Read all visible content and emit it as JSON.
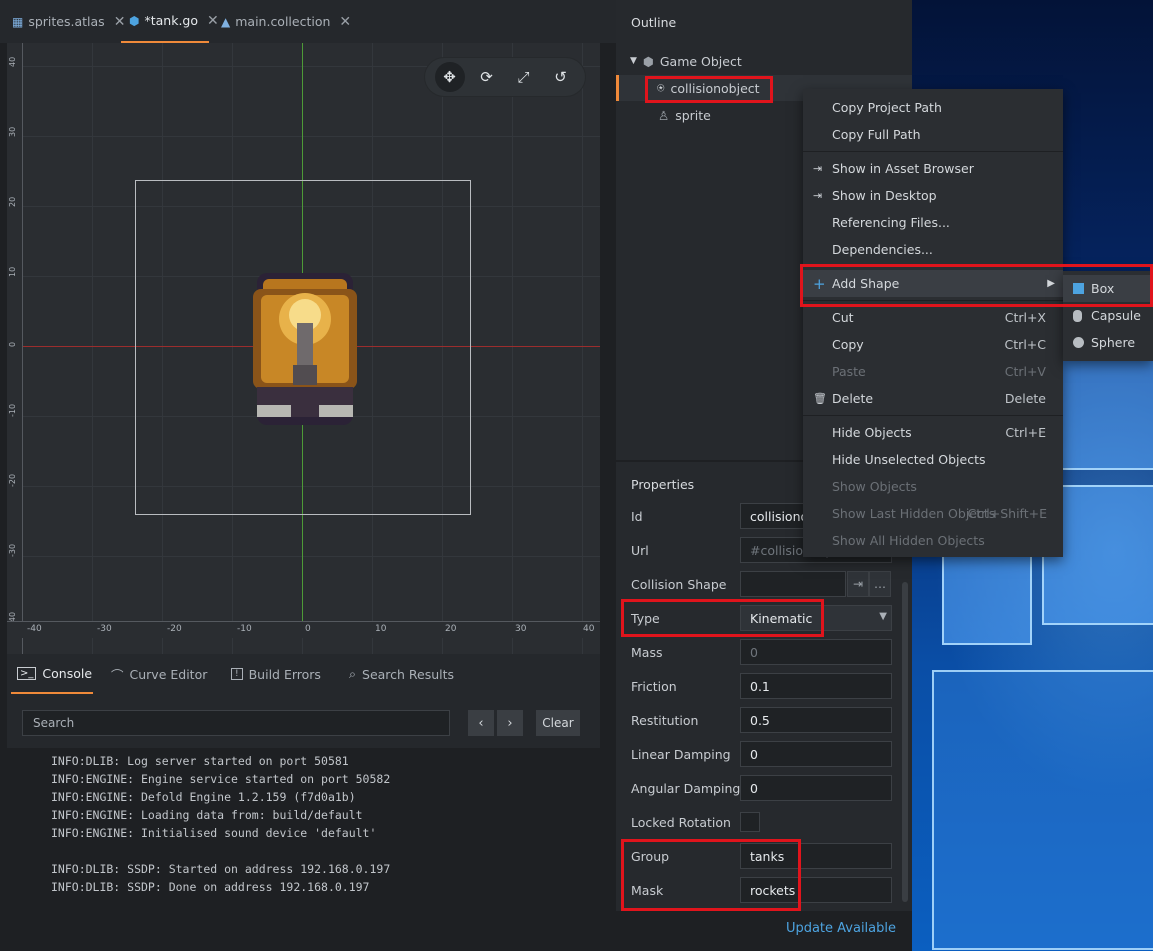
{
  "editor_tabs": [
    {
      "label": "sprites.atlas"
    },
    {
      "label": "*tank.go"
    },
    {
      "label": "main.collection"
    }
  ],
  "scene": {
    "y_ticks": [
      "40",
      "30",
      "20",
      "10",
      "0",
      "-10",
      "-20",
      "-30",
      "-40"
    ],
    "x_ticks": [
      "-40",
      "-30",
      "-20",
      "-10",
      "0",
      "10",
      "20",
      "30",
      "40"
    ],
    "tools": [
      "move-tool-icon",
      "rotate-tool-icon",
      "scale-tool-icon",
      "camera-tool-icon"
    ]
  },
  "bottom_tabs": [
    {
      "label": "Console"
    },
    {
      "label": "Curve Editor"
    },
    {
      "label": "Build Errors"
    },
    {
      "label": "Search Results"
    }
  ],
  "console": {
    "search_placeholder": "Search",
    "prev_symbol": "‹",
    "next_symbol": "›",
    "clear_label": "Clear",
    "log": "INFO:DLIB: Log server started on port 50581\nINFO:ENGINE: Engine service started on port 50582\nINFO:ENGINE: Defold Engine 1.2.159 (f7d0a1b)\nINFO:ENGINE: Loading data from: build/default\nINFO:ENGINE: Initialised sound device 'default'\n\nINFO:DLIB: SSDP: Started on address 192.168.0.197\nINFO:DLIB: SSDP: Done on address 192.168.0.197"
  },
  "outline": {
    "title": "Outline",
    "root": "Game Object",
    "children": [
      "collisionobject",
      "sprite"
    ]
  },
  "properties": {
    "title": "Properties",
    "id_label": "Id",
    "id_value": "collisionobject",
    "url_label": "Url",
    "url_value": "#collisionobject",
    "shape_label": "Collision Shape",
    "type_label": "Type",
    "type_value": "Kinematic",
    "mass_label": "Mass",
    "mass_value": "0",
    "friction_label": "Friction",
    "friction_value": "0.1",
    "restitution_label": "Restitution",
    "restitution_value": "0.5",
    "linear_label": "Linear Damping",
    "linear_value": "0",
    "angular_label": "Angular Damping",
    "angular_value": "0",
    "locked_label": "Locked Rotation",
    "group_label": "Group",
    "group_value": "tanks",
    "mask_label": "Mask",
    "mask_value": "rockets"
  },
  "status": {
    "update": "Update Available"
  },
  "context_menu": {
    "copy_project_path": "Copy Project Path",
    "copy_full_path": "Copy Full Path",
    "show_asset_browser": "Show in Asset Browser",
    "show_desktop": "Show in Desktop",
    "referencing_files": "Referencing Files...",
    "dependencies": "Dependencies...",
    "add_shape": "Add Shape",
    "cut": "Cut",
    "cut_sc": "Ctrl+X",
    "copy": "Copy",
    "copy_sc": "Ctrl+C",
    "paste": "Paste",
    "paste_sc": "Ctrl+V",
    "delete": "Delete",
    "delete_sc": "Delete",
    "hide_objects": "Hide Objects",
    "hide_objects_sc": "Ctrl+E",
    "hide_unselected": "Hide Unselected Objects",
    "show_objects": "Show Objects",
    "show_last_hidden": "Show Last Hidden Objects",
    "show_last_hidden_sc": "Ctrl+Shift+E",
    "show_all_hidden": "Show All Hidden Objects"
  },
  "shape_submenu": {
    "box": "Box",
    "capsule": "Capsule",
    "sphere": "Sphere"
  },
  "colors": {
    "accent": "#f08a3a",
    "highlight_box": "#e0141c",
    "link": "#4da3e0"
  }
}
